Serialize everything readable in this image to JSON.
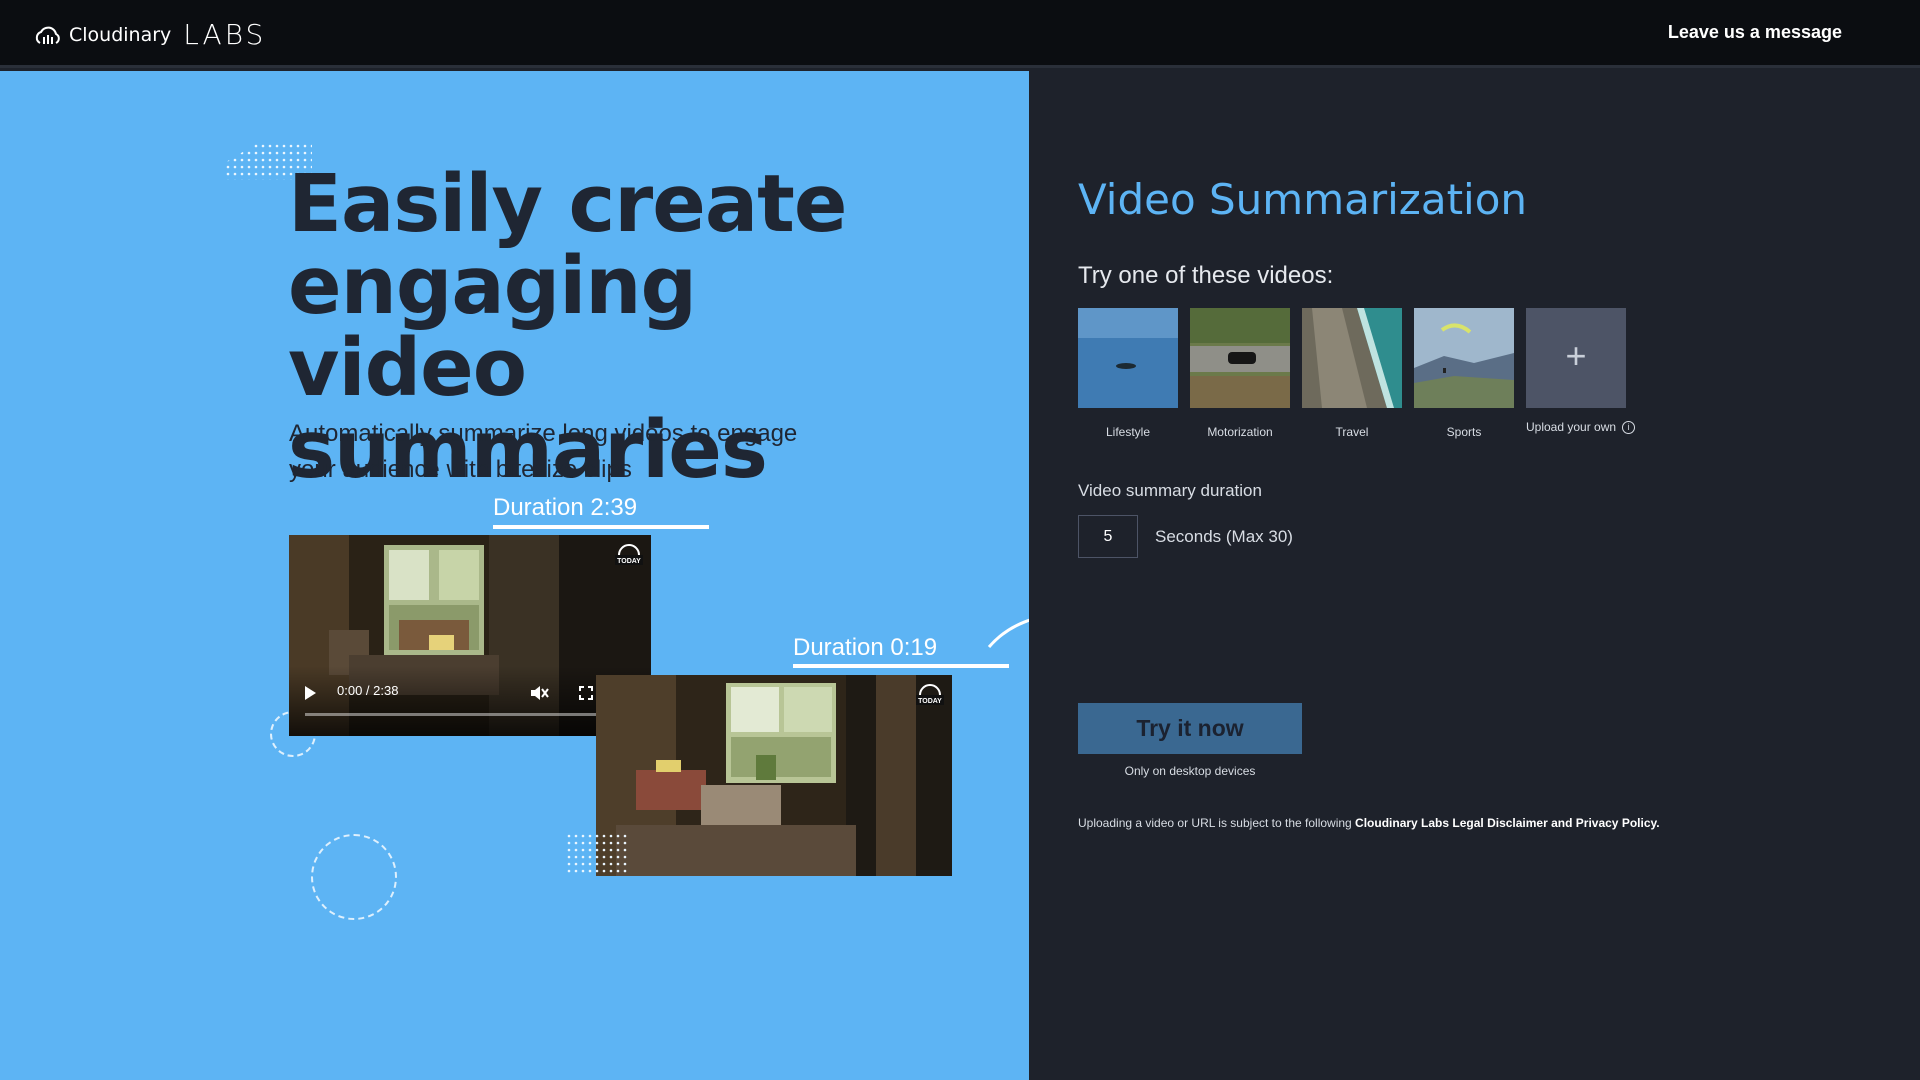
{
  "nav": {
    "brand": "Cloudinary",
    "labs": "LABS",
    "message_link": "Leave us a message"
  },
  "hero": {
    "title": "Easily create engaging video summaries",
    "subtitle": "Automatically summarize long videos to engage your audience with bitesize clips",
    "original_duration": "Duration 2:39",
    "summary_duration": "Duration 0:19",
    "player_time": "0:00 / 2:38"
  },
  "panel": {
    "title": "Video Summarization",
    "try_label": "Try one of these videos:",
    "samples": [
      {
        "label": "Lifestyle"
      },
      {
        "label": "Motorization"
      },
      {
        "label": "Travel"
      },
      {
        "label": "Sports"
      }
    ],
    "upload_label": "Upload your own",
    "upload_icon": "plus-icon",
    "duration_label": "Video summary duration",
    "duration_value": "5",
    "duration_unit": "Seconds (Max 30)",
    "cta": "Try it now",
    "cta_note": "Only on desktop devices",
    "legal_prefix": "Uploading a video or URL is subject to the following ",
    "legal_link": "Cloudinary Labs Legal Disclaimer and Privacy Policy."
  },
  "colors": {
    "hero_bg": "#5db4f4",
    "panel_bg": "#1e222b",
    "nav_bg": "#0b0d11",
    "accent": "#5db4f4",
    "cta_bg": "#3a6891"
  }
}
